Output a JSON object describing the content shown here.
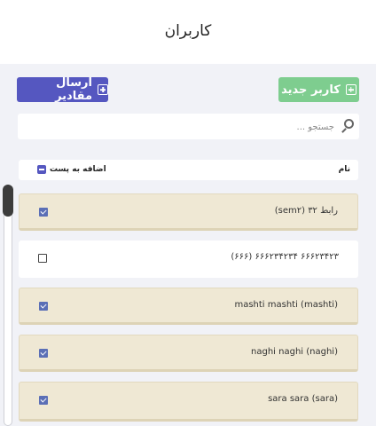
{
  "header": {
    "title": "کاربران"
  },
  "toolbar": {
    "new_user_label": "کاربر جدید",
    "send_values_label": "ارسال مقادیر"
  },
  "search": {
    "placeholder": "جستجو ..."
  },
  "table": {
    "columns": {
      "name": "نام",
      "add_to_post": "اضافه به پست"
    },
    "rows": [
      {
        "label": "رابط ۳۲ (sem۲)",
        "checked": true
      },
      {
        "label": "۶۶۶۲۳۴۲۳ ۶۶۶۲۳۴۲۳۴ (۶۶۶)",
        "checked": false
      },
      {
        "label": "(mashti) mashti mashti",
        "checked": true
      },
      {
        "label": "(naghi) naghi naghi",
        "checked": true
      },
      {
        "label": "(sara) sara sara",
        "checked": true
      }
    ]
  },
  "colors": {
    "accent_green": "#7ecd8f",
    "accent_blue": "#5557c0",
    "selected_row": "#efe8d4",
    "background": "#f1f2f7"
  }
}
